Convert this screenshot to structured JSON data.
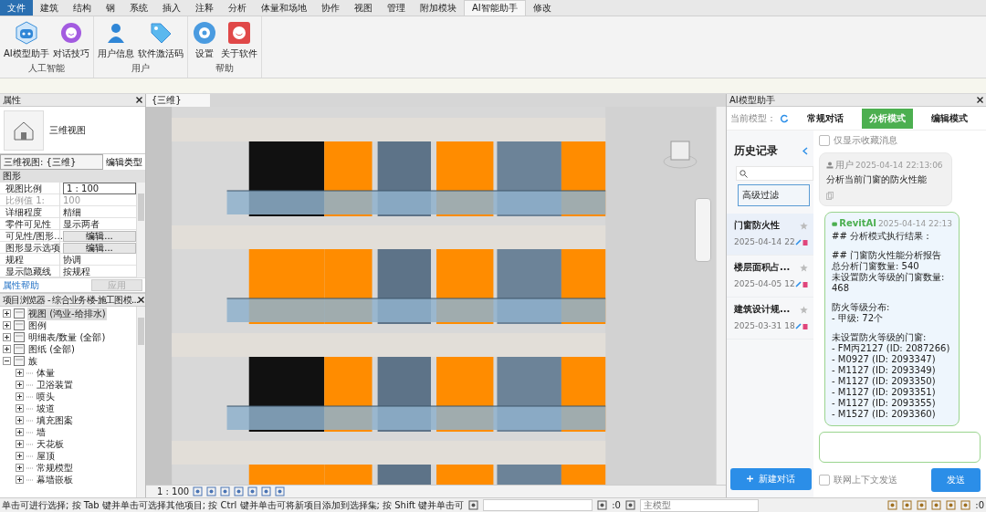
{
  "menu_tabs": [
    {
      "label": "文件",
      "kind": "application",
      "selected": false
    },
    {
      "label": "建筑",
      "kind": "tab",
      "selected": false
    },
    {
      "label": "结构",
      "kind": "tab",
      "selected": false
    },
    {
      "label": "钢",
      "kind": "tab",
      "selected": false
    },
    {
      "label": "系统",
      "kind": "tab",
      "selected": false
    },
    {
      "label": "插入",
      "kind": "tab",
      "selected": false
    },
    {
      "label": "注释",
      "kind": "tab",
      "selected": false
    },
    {
      "label": "分析",
      "kind": "tab",
      "selected": false
    },
    {
      "label": "体量和场地",
      "kind": "tab",
      "selected": false
    },
    {
      "label": "协作",
      "kind": "tab",
      "selected": false
    },
    {
      "label": "视图",
      "kind": "tab",
      "selected": false
    },
    {
      "label": "管理",
      "kind": "tab",
      "selected": false
    },
    {
      "label": "附加模块",
      "kind": "tab",
      "selected": false
    },
    {
      "label": "AI智能助手",
      "kind": "tab",
      "selected": true
    },
    {
      "label": "修改",
      "kind": "tab",
      "selected": false
    }
  ],
  "ribbon_groups": [
    {
      "label": "人工智能",
      "buttons": [
        "AI模型助手",
        "对话技巧"
      ]
    },
    {
      "label": "用户",
      "buttons": [
        "用户信息",
        "软件激活码"
      ]
    },
    {
      "label": "帮助",
      "buttons": [
        "设置",
        "关于软件"
      ]
    }
  ],
  "properties": {
    "title": "属性",
    "type_name": "三维视图",
    "view_selector": "三维视图: {三维}",
    "edit_type": "编辑类型",
    "section": "图形",
    "rows": [
      {
        "label": "视图比例",
        "value": "1 : 100",
        "kind": "input"
      },
      {
        "label": "比例值 1:",
        "value": "100",
        "kind": "disabled"
      },
      {
        "label": "详细程度",
        "value": "精细",
        "kind": "text"
      },
      {
        "label": "零件可见性",
        "value": "显示两者",
        "kind": "text"
      },
      {
        "label": "可见性/图形...",
        "value": "编辑...",
        "kind": "button"
      },
      {
        "label": "图形显示选项",
        "value": "编辑...",
        "kind": "button"
      },
      {
        "label": "规程",
        "value": "协调",
        "kind": "text"
      },
      {
        "label": "显示隐藏线",
        "value": "按规程",
        "kind": "text"
      }
    ],
    "help_link": "属性帮助",
    "apply": {
      "label": "应用",
      "disabled": true
    }
  },
  "project_browser": {
    "title": "项目浏览器 - 综合业务楼-施工图模...",
    "items": [
      {
        "label": "视图 (鸿业-给排水)",
        "expanded": false,
        "selected": true
      },
      {
        "label": "图例",
        "expanded": false,
        "selected": false
      },
      {
        "label": "明细表/数量 (全部)",
        "expanded": false,
        "selected": false
      },
      {
        "label": "图纸 (全部)",
        "expanded": false,
        "selected": false
      },
      {
        "label": "族",
        "expanded": true,
        "selected": false,
        "children": [
          {
            "label": "体量",
            "expanded": false,
            "selected": false
          },
          {
            "label": "卫浴装置",
            "expanded": false,
            "selected": false
          },
          {
            "label": "喷头",
            "expanded": false,
            "selected": false
          },
          {
            "label": "坡道",
            "expanded": false,
            "selected": false
          },
          {
            "label": "填充图案",
            "expanded": false,
            "selected": false
          },
          {
            "label": "墙",
            "expanded": false,
            "selected": false
          },
          {
            "label": "天花板",
            "expanded": false,
            "selected": false
          },
          {
            "label": "屋顶",
            "expanded": false,
            "selected": false
          },
          {
            "label": "常规模型",
            "expanded": false,
            "selected": false
          },
          {
            "label": "幕墙嵌板",
            "expanded": false,
            "selected": false
          }
        ]
      }
    ]
  },
  "view_tab": {
    "label": "{三维}"
  },
  "view_scale": "1 : 100",
  "ai_panel": {
    "title": "AI模型助手",
    "model_label": "当前模型：",
    "modes": [
      {
        "label": "常规对话",
        "selected": false
      },
      {
        "label": "分析模式",
        "selected": true
      },
      {
        "label": "编辑模式",
        "selected": false
      }
    ],
    "history": {
      "title": "历史记录",
      "filter": "高级过滤",
      "items": [
        {
          "title": "门窗防火性",
          "date": "2025-04-14 22",
          "selected": true
        },
        {
          "title": "楼层面积占...",
          "date": "2025-04-05 12",
          "selected": false
        },
        {
          "title": "建筑设计规...",
          "date": "2025-03-31 18",
          "selected": false
        }
      ],
      "new_chat": "新建对话"
    },
    "favorites_only": {
      "label": "仅显示收藏消息",
      "checked": false
    },
    "messages": [
      {
        "kind": "user",
        "sender": "用户",
        "time": "2025-04-14 22:13:06",
        "paragraphs": [
          [
            "分析当前门窗的防火性能"
          ]
        ]
      },
      {
        "kind": "ai",
        "sender": "RevitAI",
        "time": "2025-04-14 22:13",
        "paragraphs": [
          [
            "## 分析模式执行结果："
          ],
          [
            "## 门窗防火性能分析报告",
            "总分析门窗数量: 540",
            "未设置防火等级的门窗数量: 468"
          ],
          [
            "防火等级分布:",
            "- 甲级: 72个"
          ],
          [
            "未设置防火等级的门窗:",
            "- FM丙2127 (ID: 2087266)",
            "- M0927 (ID: 2093347)",
            "- M1127 (ID: 2093349)",
            "- M1127 (ID: 2093350)",
            "- M1127 (ID: 2093351)",
            "- M1127 (ID: 2093355)",
            "- M1527 (ID: 2093360)"
          ]
        ]
      }
    ],
    "web_context": {
      "label": "联网上下文发送",
      "checked": false
    },
    "send": "发送"
  },
  "status_bar": {
    "hint": "单击可进行选择; 按 Tab 键并单击可选择其他项目; 按 Ctrl 键并单击可将新项目添加到选择集; 按 Shift 键并单击可",
    "selection_count": ":0",
    "model": "主模型",
    "filter_count": ":0"
  }
}
